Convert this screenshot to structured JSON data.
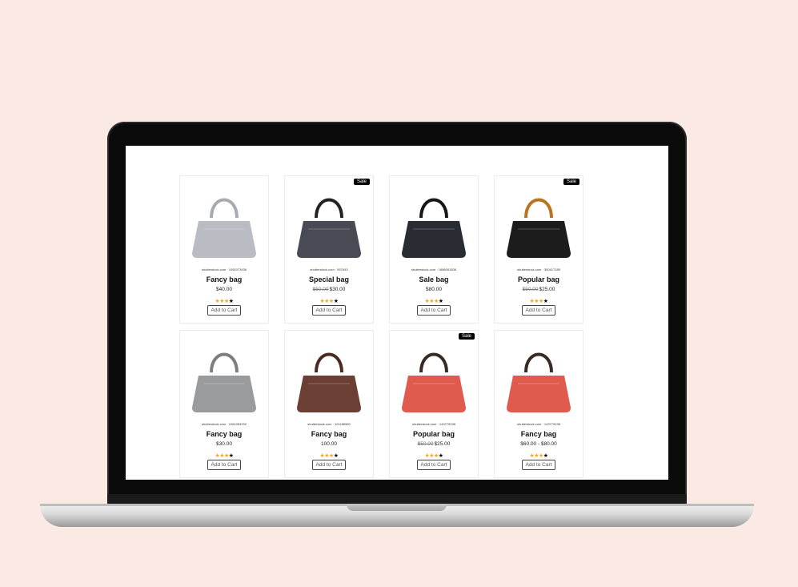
{
  "sale_label": "Sale",
  "cart_label": "Add to Cart",
  "products": [
    {
      "name": "Fancy bag",
      "price_old": "",
      "price": "$40.00",
      "stock_text": "shutterstock.com · 1091073436",
      "sale": false,
      "rating": 4,
      "color": "#b9bcc3",
      "handle": "#a7aab0"
    },
    {
      "name": "Special bag",
      "price_old": "$50.00",
      "price": "$30.00",
      "stock_text": "shutterstock.com · 597643",
      "sale": true,
      "rating": 4,
      "color": "#4a4a55",
      "handle": "#222"
    },
    {
      "name": "Sale bag",
      "price_old": "",
      "price": "$80.00",
      "stock_text": "shutterstock.com · 1686091836",
      "sale": false,
      "rating": 4,
      "color": "#2a2c33",
      "handle": "#15161a"
    },
    {
      "name": "Popular bag",
      "price_old": "$50.00",
      "price": "$25.00",
      "stock_text": "shutterstock.com · 300417185",
      "sale": true,
      "rating": 4,
      "color": "#1c1c1c",
      "handle": "#b8741f"
    },
    {
      "name": "Fancy bag",
      "price_old": "",
      "price": "$30.00",
      "stock_text": "shutterstock.com · 1061053232",
      "sale": false,
      "rating": 4,
      "color": "#9a9b9c",
      "handle": "#7d7e7f"
    },
    {
      "name": "Fancy bag",
      "price_old": "",
      "price": "100.00",
      "stock_text": "shutterstock.com · 101186565",
      "sale": false,
      "rating": 4,
      "color": "#6b3f33",
      "handle": "#4a2a22"
    },
    {
      "name": "Popular bag",
      "price_old": "$50.00",
      "price": "$25.00",
      "stock_text": "shutterstock.com · 143779238",
      "sale": true,
      "rating": 4,
      "color": "#e05b4e",
      "handle": "#3a2a25"
    },
    {
      "name": "Fancy bag",
      "price_old": "",
      "price": "$60.00 - $80.00",
      "stock_text": "shutterstock.com · 143779238",
      "sale": false,
      "rating": 4,
      "color": "#e05b4e",
      "handle": "#3a2a25"
    }
  ]
}
